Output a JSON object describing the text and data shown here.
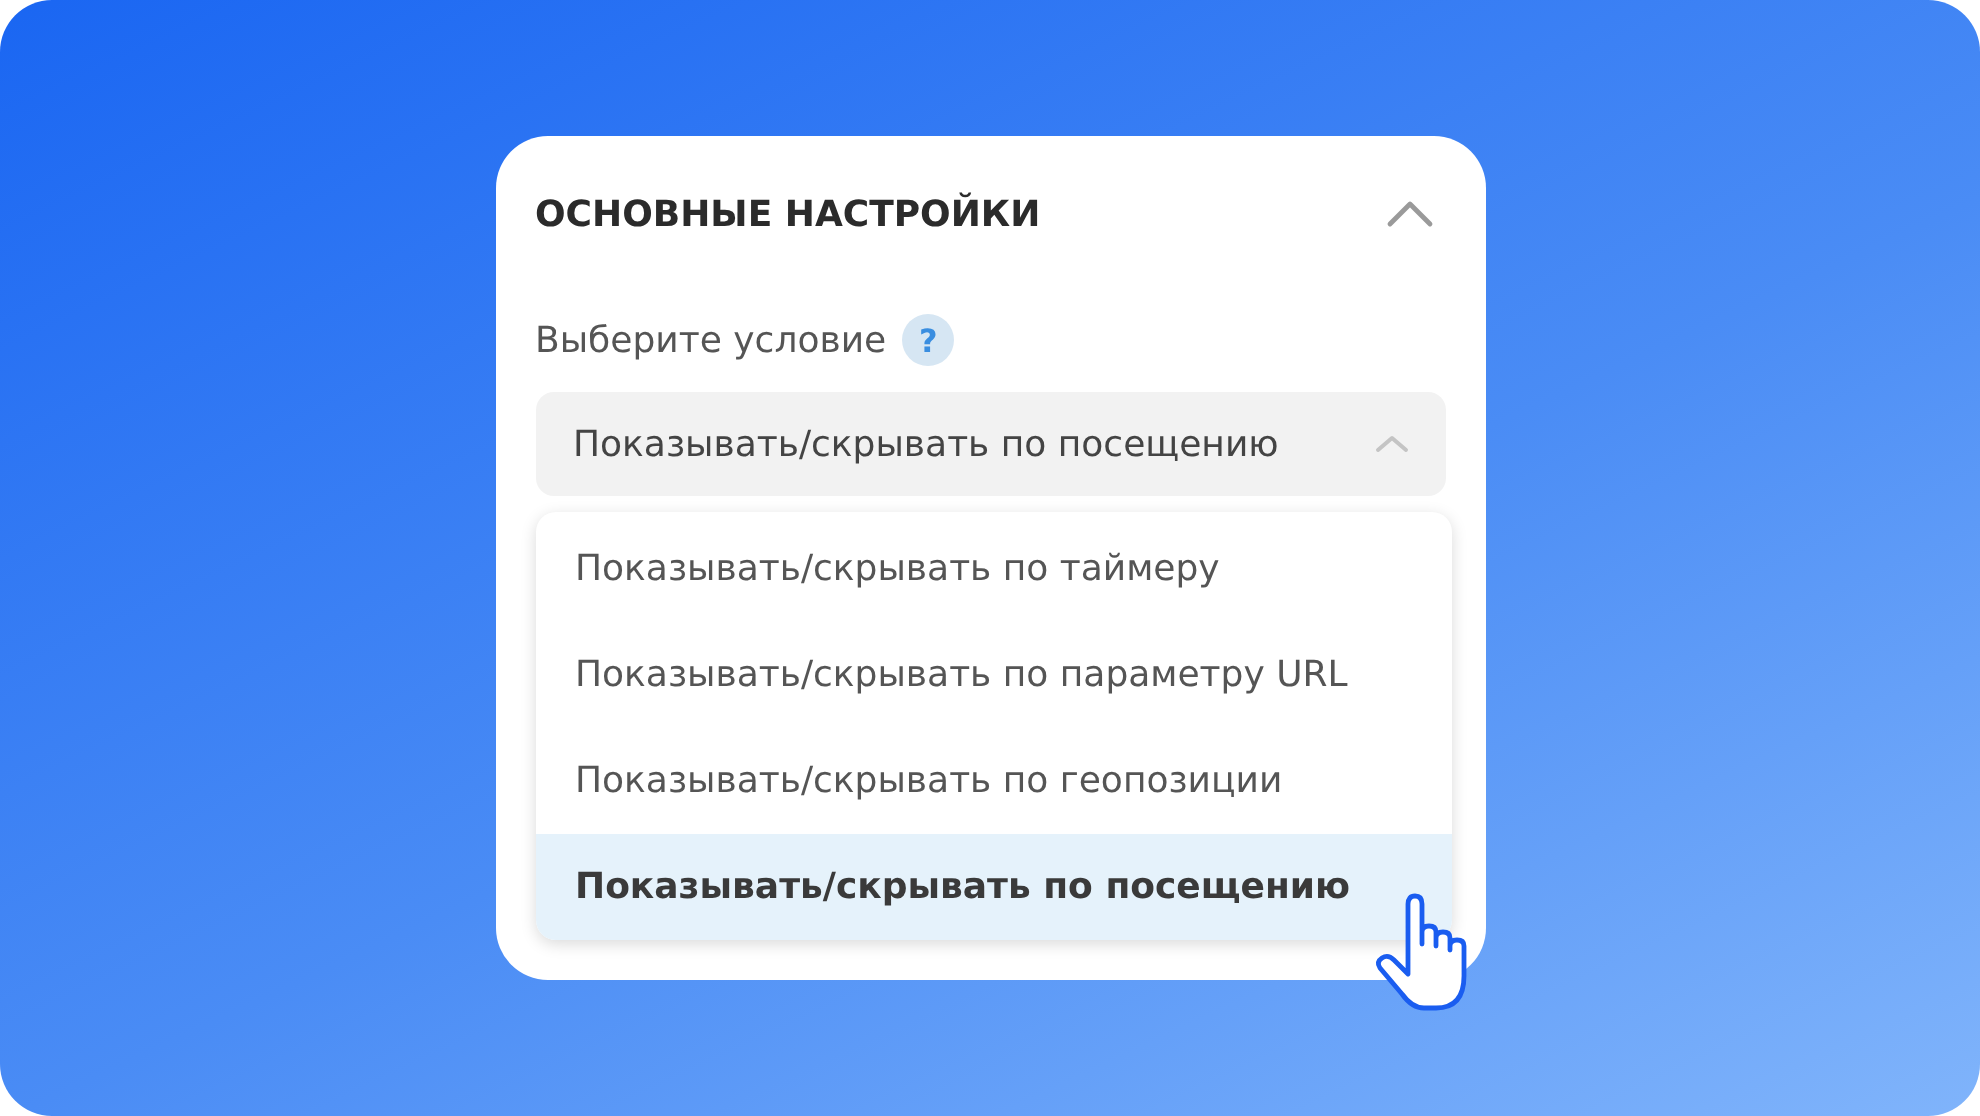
{
  "section": {
    "title": "ОСНОВНЫЕ НАСТРОЙКИ",
    "expanded": true
  },
  "condition": {
    "label": "Выберите условие",
    "help": "?",
    "value": "Показывать/скрывать по посещению",
    "open": true,
    "options": [
      {
        "label": "Показывать/скрывать по таймеру",
        "selected": false
      },
      {
        "label": "Показывать/скрывать по параметру URL",
        "selected": false
      },
      {
        "label": "Показывать/скрывать по геопозиции",
        "selected": false
      },
      {
        "label": "Показывать/скрывать по посещению",
        "selected": true
      }
    ]
  }
}
